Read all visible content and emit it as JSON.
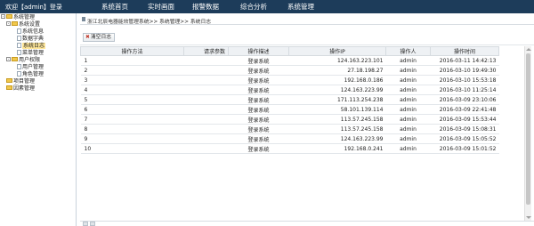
{
  "header": {
    "welcome": "欢迎【admin】登录",
    "nav": [
      "系统首页",
      "实时画面",
      "报警数据",
      "综合分析",
      "系统管理"
    ]
  },
  "sidebar": {
    "tree": [
      {
        "label": "系统管理",
        "toggle": "-",
        "icon": "folder"
      },
      {
        "label": "系统设置",
        "toggle": "-",
        "icon": "folder"
      },
      {
        "label": "系统信息",
        "icon": "file"
      },
      {
        "label": "数据字典",
        "icon": "file"
      },
      {
        "label": "系统日志",
        "icon": "file",
        "selected": true
      },
      {
        "label": "菜单管理",
        "icon": "file"
      },
      {
        "label": "用户权限",
        "toggle": "-",
        "icon": "folder"
      },
      {
        "label": "用户管理",
        "icon": "file"
      },
      {
        "label": "角色管理",
        "icon": "file"
      },
      {
        "label": "项目管理",
        "icon": "folder"
      },
      {
        "label": "因素管理",
        "icon": "folder"
      }
    ]
  },
  "breadcrumb": "浙江北辰电器能效管理系统>> 系统管理>> 系统日志",
  "toolbar": {
    "clear_label": "清空日志"
  },
  "table": {
    "columns": [
      "操作方法",
      "请求参数",
      "操作描述",
      "操作IP",
      "操作人",
      "操作时间"
    ],
    "rows": [
      [
        "1",
        "",
        "登录系统",
        "124.163.223.101",
        "admin",
        "2016-03-11 14:42:13"
      ],
      [
        "2",
        "",
        "登录系统",
        "27.18.198.27",
        "admin",
        "2016-03-10 19:49:30"
      ],
      [
        "3",
        "",
        "登录系统",
        "192.168.0.186",
        "admin",
        "2016-03-10 15:53:18"
      ],
      [
        "4",
        "",
        "登录系统",
        "124.163.223.99",
        "admin",
        "2016-03-10 11:25:14"
      ],
      [
        "5",
        "",
        "登录系统",
        "171.113.254.238",
        "admin",
        "2016-03-09 23:10:06"
      ],
      [
        "6",
        "",
        "登录系统",
        "58.101.139.114",
        "admin",
        "2016-03-09 22:41:48"
      ],
      [
        "7",
        "",
        "登录系统",
        "113.57.245.158",
        "admin",
        "2016-03-09 15:53:44"
      ],
      [
        "8",
        "",
        "登录系统",
        "113.57.245.158",
        "admin",
        "2016-03-09 15:08:31"
      ],
      [
        "9",
        "",
        "登录系统",
        "124.163.223.99",
        "admin",
        "2016-03-09 15:05:52"
      ],
      [
        "10",
        "",
        "登录系统",
        "192.168.0.241",
        "admin",
        "2016-03-09 15:01:52"
      ]
    ]
  }
}
